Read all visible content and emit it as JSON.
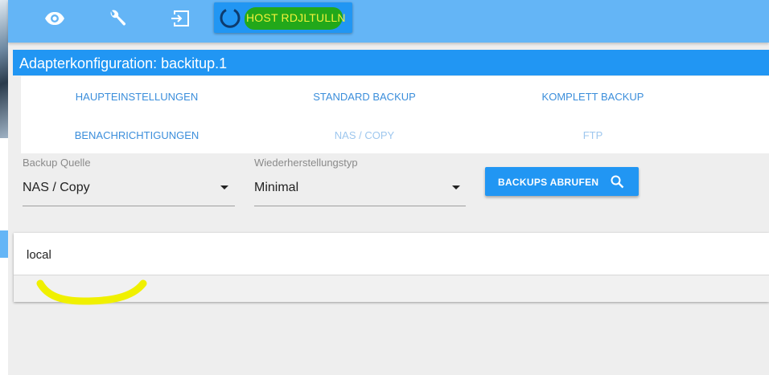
{
  "toolbar": {
    "icons": [
      "eye-icon",
      "wrench-icon",
      "logout-icon",
      "power-icon"
    ],
    "host_label": "HOST RDJLTULLN",
    "colors": {
      "bar": "#64b5f6",
      "button": "#2196f3",
      "highlight_green": "#22a81a",
      "highlight_text": "#f2f23a"
    }
  },
  "panel": {
    "title": "Adapterkonfiguration: backitup.1"
  },
  "tabs": [
    {
      "label": "HAUPTEINSTELLUNGEN",
      "enabled": true
    },
    {
      "label": "STANDARD BACKUP",
      "enabled": true
    },
    {
      "label": "KOMPLETT BACKUP",
      "enabled": true
    },
    {
      "label": "BENACHRICHTIGUNGEN",
      "enabled": true
    },
    {
      "label": "NAS / COPY",
      "enabled": false
    },
    {
      "label": "FTP",
      "enabled": false
    }
  ],
  "form": {
    "source": {
      "label": "Backup Quelle",
      "value": "NAS / Copy"
    },
    "restore_type": {
      "label": "Wiederherstellungstyp",
      "value": "Minimal"
    },
    "fetch_button": {
      "label": "BACKUPS ABRUFEN",
      "icon": "search-icon"
    }
  },
  "list": {
    "items": [
      "local"
    ]
  },
  "colors": {
    "accent": "#2196f3",
    "scribble_yellow": "#f0f000"
  }
}
